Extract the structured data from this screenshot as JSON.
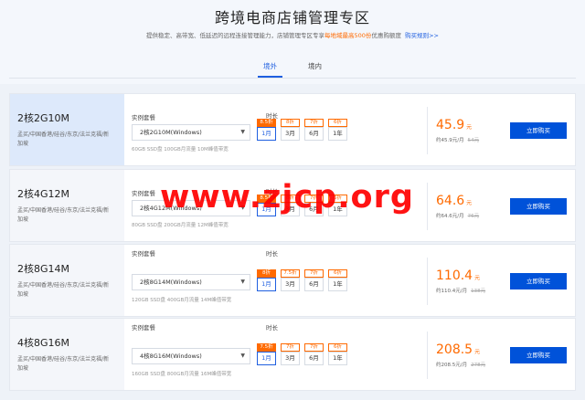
{
  "header": {
    "title": "跨境电商店铺管理专区",
    "subtitle_prefix": "提供稳定、高带宽、低延迟的远程连接管理能力，店铺管理专区专享",
    "subtitle_highlight": "每地域最高500份",
    "subtitle_suffix": "优惠购额度",
    "rule_link": "购买规则>>"
  },
  "tabs": [
    {
      "label": "境外"
    },
    {
      "label": "境内"
    }
  ],
  "colors": {
    "accent": "#0052d9",
    "price": "#ff6a00"
  },
  "labels": {
    "instance": "实例套餐",
    "duration": "时长",
    "buy": "立即购买",
    "yuan": "元"
  },
  "products": [
    {
      "name": "2核2G10M",
      "desc": "孟买/中国香港/硅谷/东京/法兰克福/新加坡",
      "select": "2核2G10M(Windows)",
      "note": "60GB SSD盘 100GB月流量 10M峰值带宽",
      "durations": [
        {
          "label": "1月",
          "discount": "8.5折"
        },
        {
          "label": "3月",
          "discount": "8折"
        },
        {
          "label": "6月",
          "discount": "7折"
        },
        {
          "label": "1年",
          "discount": "6折"
        }
      ],
      "price": "45.9",
      "monthly": "约45.9元/月",
      "original": "54元"
    },
    {
      "name": "2核4G12M",
      "desc": "孟买/中国香港/硅谷/东京/法兰克福/新加坡",
      "select": "2核4G12M(Windows)",
      "note": "80GB SSD盘 200GB月流量 12M峰值带宽",
      "durations": [
        {
          "label": "1月",
          "discount": "8.5折"
        },
        {
          "label": "3月",
          "discount": "8折"
        },
        {
          "label": "6月",
          "discount": "7折"
        },
        {
          "label": "1年",
          "discount": "6折"
        }
      ],
      "price": "64.6",
      "monthly": "约64.6元/月",
      "original": "76元"
    },
    {
      "name": "2核8G14M",
      "desc": "孟买/中国香港/硅谷/东京/法兰克福/新加坡",
      "select": "2核8G14M(Windows)",
      "note": "120GB SSD盘 400GB月流量 14M峰值带宽",
      "durations": [
        {
          "label": "1月",
          "discount": "8折"
        },
        {
          "label": "3月",
          "discount": "7.5折"
        },
        {
          "label": "6月",
          "discount": "7折"
        },
        {
          "label": "1年",
          "discount": "6折"
        }
      ],
      "price": "110.4",
      "monthly": "约110.4元/月",
      "original": "138元"
    },
    {
      "name": "4核8G16M",
      "desc": "孟买/中国香港/硅谷/东京/法兰克福/新加坡",
      "select": "4核8G16M(Windows)",
      "note": "160GB SSD盘 800GB月流量 16M峰值带宽",
      "durations": [
        {
          "label": "1月",
          "discount": "7.5折"
        },
        {
          "label": "3月",
          "discount": "7折"
        },
        {
          "label": "6月",
          "discount": "7折"
        },
        {
          "label": "1年",
          "discount": "6折"
        }
      ],
      "price": "208.5",
      "monthly": "约208.5元/月",
      "original": "278元"
    }
  ],
  "watermark": "www.zjcp.org"
}
